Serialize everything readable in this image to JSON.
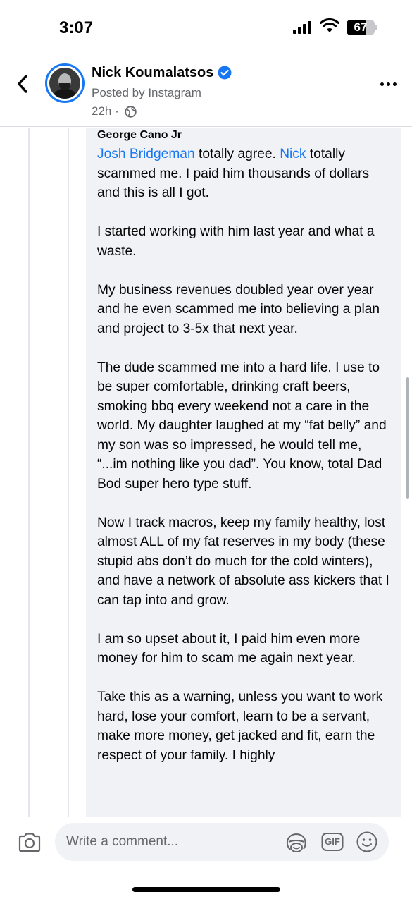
{
  "status_bar": {
    "time": "3:07",
    "battery_percent": "67",
    "battery_level": 0.67,
    "signal_icon": "cellular-signal-icon",
    "wifi_icon": "wifi-icon"
  },
  "header": {
    "back_icon": "chevron-left-icon",
    "author_name": "Nick Koumalatsos",
    "verified_icon": "verified-badge-icon",
    "posted_by": "Posted by Instagram",
    "post_time": "22h ·",
    "privacy_icon": "globe-icon",
    "more_icon": "more-horizontal-icon"
  },
  "comment": {
    "commenter_name": "George Cano Jr",
    "mention_1": "Josh Bridgeman",
    "text_1": " totally agree. ",
    "mention_2": "Nick",
    "text_2": " totally scammed me. I paid him thousands of dollars and this is all I got.",
    "paragraphs": [
      "I started working with him last year and what a waste.",
      "My business revenues doubled year over year and he even scammed me into believing a plan and project to 3-5x that next year.",
      "The dude scammed me into a hard life. I use to be super comfortable, drinking craft beers, smoking bbq every weekend not a care in the world. My daughter laughed at my “fat belly” and my son was so impressed, he would tell me, “...im nothing like you dad”. You know, total Dad Bod super hero type stuff.",
      "Now I track macros, keep my family healthy, lost almost ALL of my fat reserves in my body (these stupid abs don’t do much for the cold winters), and have a network of absolute ass kickers that I can tap into and grow.",
      "I am so upset about it, I paid him even more money for him to scam me again next year.",
      "Take this as a warning, unless you want to work hard, lose your comfort, learn to be a servant, make more money, get jacked and fit, earn the respect of your family. I highly"
    ]
  },
  "composer": {
    "camera_icon": "camera-icon",
    "placeholder": "Write a comment...",
    "avatar_sticker_icon": "avatar-sticker-icon",
    "gif_label": "GIF",
    "emoji_icon": "smiley-icon"
  },
  "colors": {
    "accent": "#1877f2",
    "bubble": "#f0f2f5",
    "secondary_text": "#65676b"
  }
}
